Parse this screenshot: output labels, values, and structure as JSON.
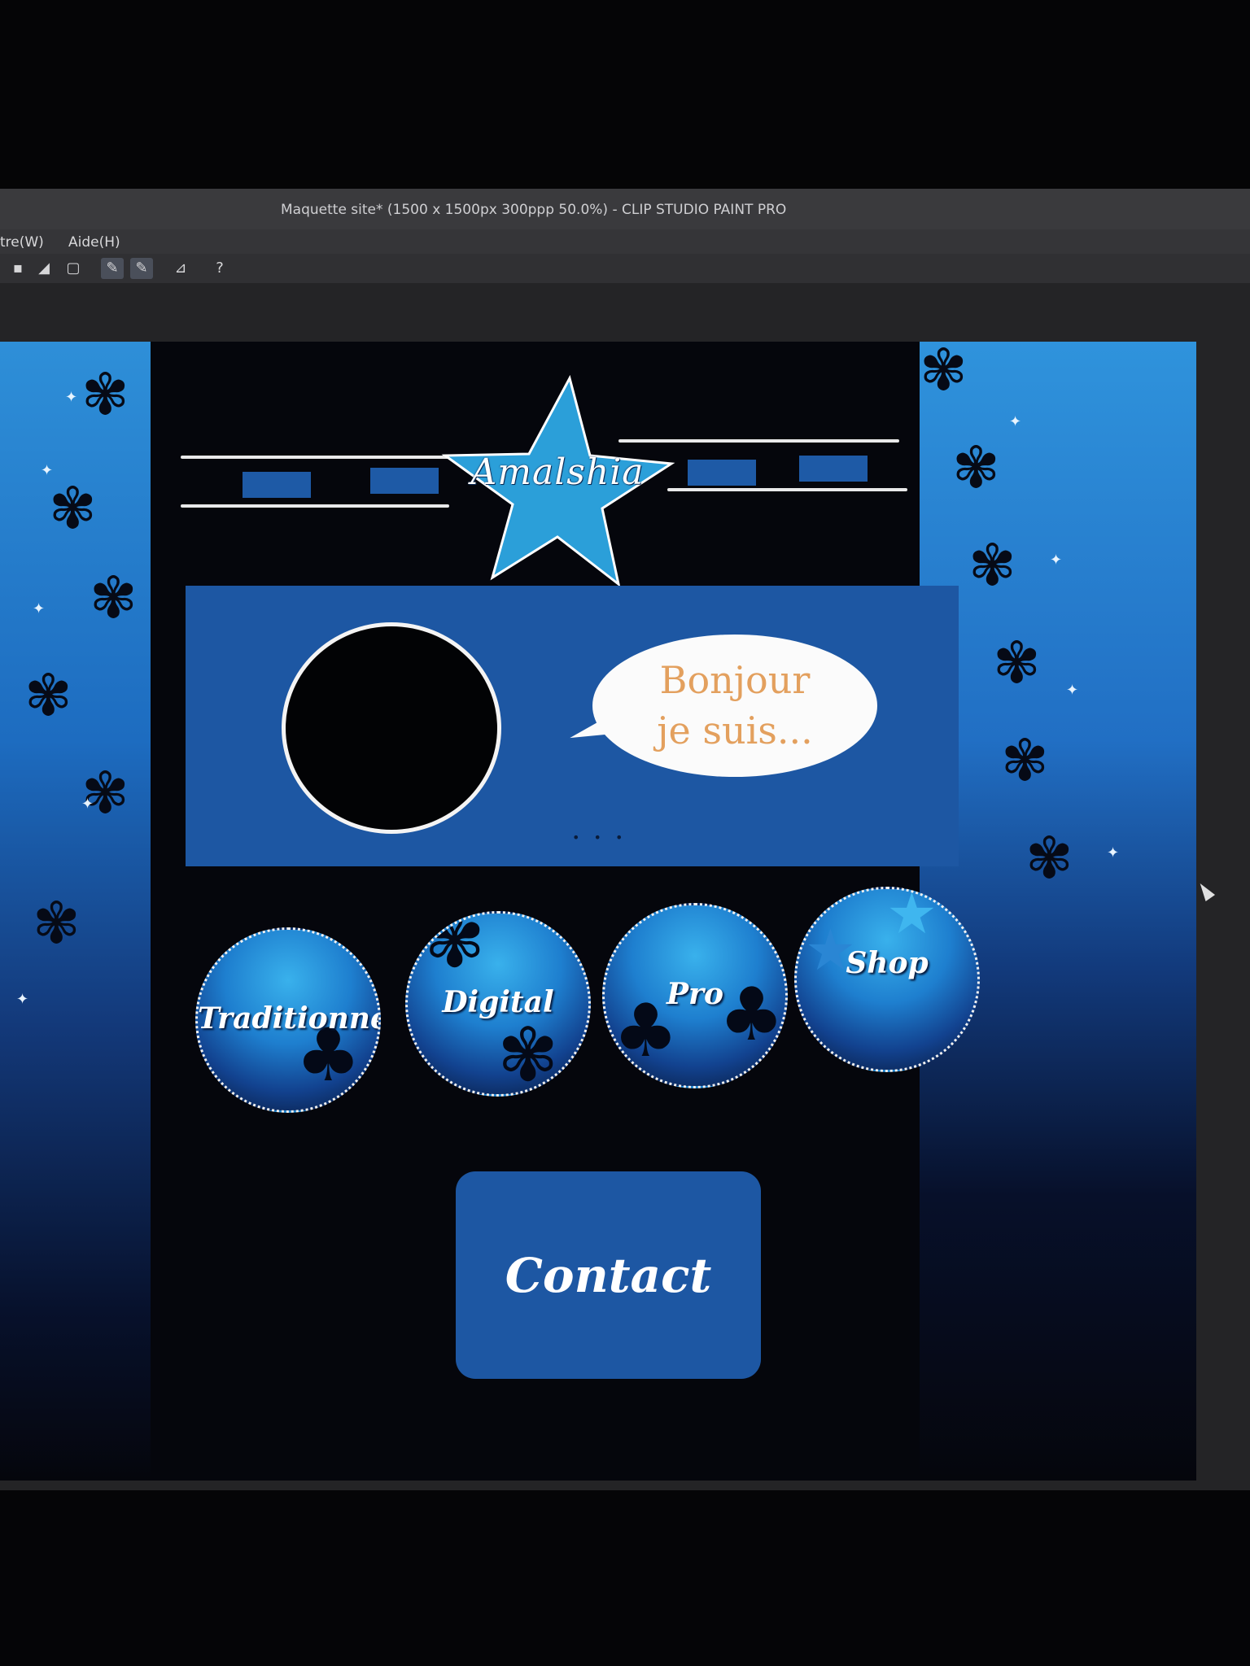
{
  "app": {
    "title": "Maquette site* (1500 x 1500px 300ppp 50.0%) - CLIP STUDIO PAINT PRO"
  },
  "menu": {
    "items": [
      "tre(W)",
      "Aide(H)"
    ]
  },
  "mockup": {
    "logo_text": "Amalshia",
    "greeting_line1": "Bonjour",
    "greeting_line2": "je suis...",
    "pager_dots": "• • •",
    "categories": [
      {
        "label": "Traditionnel"
      },
      {
        "label": "Digital"
      },
      {
        "label": "Pro"
      },
      {
        "label": "Shop"
      }
    ],
    "contact_label": "Contact"
  },
  "colors": {
    "canvas_bg": "#05060c",
    "banner_blue": "#1d57a3",
    "sky_blue": "#2e8fd8",
    "bubble_text": "#e3a05e",
    "logo_star": "#2b9fd9"
  }
}
